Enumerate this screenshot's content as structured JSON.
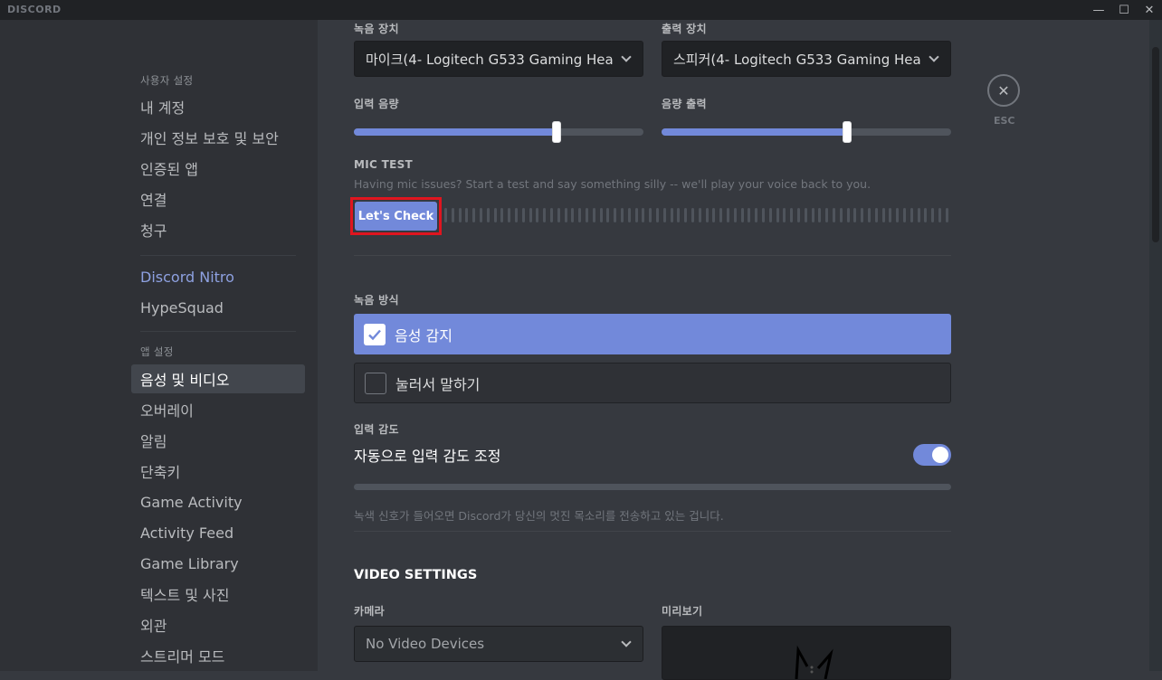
{
  "titlebar": {
    "brand": "DISCORD",
    "minimize_icon": "minimize-icon",
    "maximize_icon": "maximize-icon",
    "close_icon": "close-icon"
  },
  "sidebar": {
    "user_settings_header": "사용자 설정",
    "user_items": [
      "내 계정",
      "개인 정보 보호 및 보안",
      "인증된 앱",
      "연결",
      "청구"
    ],
    "nitro": "Discord Nitro",
    "hypesquad": "HypeSquad",
    "app_settings_header": "앱 설정",
    "app_items": [
      "음성 및 비디오",
      "오버레이",
      "알림",
      "단축키",
      "Game Activity",
      "Activity Feed",
      "Game Library",
      "텍스트 및 사진",
      "외관",
      "스트리머 모드"
    ],
    "selected": "음성 및 비디오"
  },
  "voice": {
    "input_device_label": "녹음 장치",
    "input_device_value": "마이크(4- Logitech G533 Gaming Hea",
    "output_device_label": "출력 장치",
    "output_device_value": "스피커(4- Logitech G533 Gaming Hea",
    "input_volume_label": "입력 음량",
    "input_volume_pct": 70,
    "output_volume_label": "음량 출력",
    "output_volume_pct": 64,
    "mic_test_label": "MIC TEST",
    "mic_test_desc": "Having mic issues? Start a test and say something silly -- we'll play your voice back to you.",
    "mic_test_button": "Let's Check",
    "input_mode_label": "녹음 방식",
    "input_mode_options": [
      "음성 감지",
      "눌러서 말하기"
    ],
    "input_mode_selected": "음성 감지",
    "sensitivity_label": "입력 감도",
    "auto_sensitivity_title": "자동으로 입력 감도 조정",
    "auto_sensitivity_on": true,
    "sensitivity_desc": "녹색 신호가 들어오면 Discord가 당신의 멋진 목소리를 전송하고 있는 겁니다."
  },
  "video": {
    "section_title": "VIDEO SETTINGS",
    "camera_label": "카메라",
    "camera_value": "No Video Devices",
    "preview_label": "미리보기"
  },
  "close": {
    "label": "ESC",
    "icon": "close-icon"
  },
  "colors": {
    "accent": "#7289da",
    "highlight_box": "#e0151f",
    "bg_content": "#36393f",
    "bg_sidebar": "#2f3136",
    "titlebar": "#202225"
  }
}
